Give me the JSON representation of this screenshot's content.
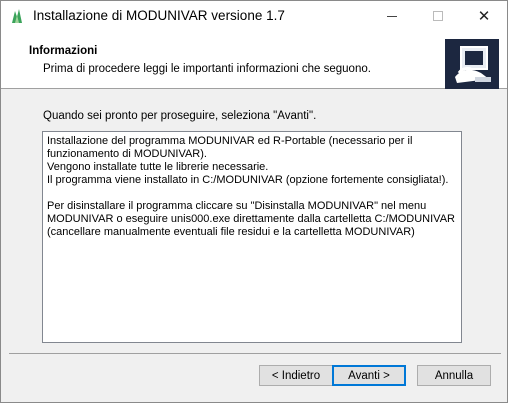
{
  "window": {
    "title": "Installazione di MODUNIVAR versione 1.7",
    "controls": {
      "minimize": "minimize-icon",
      "maximize": "maximize-icon",
      "close": "✕"
    }
  },
  "header": {
    "title": "Informazioni",
    "subtitle": "Prima di procedere leggi le importanti informazioni che seguono."
  },
  "body": {
    "intro": "Quando sei pronto per proseguire, seleziona \"Avanti\".",
    "memo_paragraphs": [
      "Installazione del programma MODUNIVAR ed R-Portable (necessario per il\nfunzionamento di MODUNIVAR).\nVengono installate tutte le librerie necessarie.\nIl programma viene installato in C:/MODUNIVAR (opzione fortemente consigliata!).",
      "Per disinstallare il programma cliccare su \"Disinstalla MODUNIVAR\" nel menu\nMODUNIVAR o eseguire unis000.exe direttamente dalla cartelletta C:/MODUNIVAR\n(cancellare manualmente eventuali file residui e la cartelletta MODUNIVAR)"
    ]
  },
  "buttons": {
    "back": "< Indietro",
    "next": "Avanti >",
    "cancel": "Annulla"
  },
  "colors": {
    "accent": "#0078d7",
    "header_bg": "#ffffff",
    "dialog_bg": "#f0f0f0"
  }
}
